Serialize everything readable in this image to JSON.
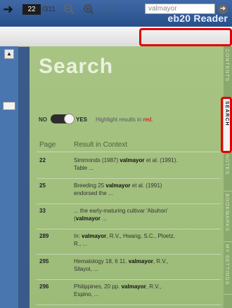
{
  "app": {
    "title": "eb20 Reader"
  },
  "toolbar": {
    "current_page": "22",
    "total_pages": "/311",
    "back_icon": "arrow-right-icon",
    "search_value": "valmayor",
    "search_go_icon": "arrow-circle-icon"
  },
  "panel": {
    "title": "Search",
    "toggle": {
      "no_label": "NO",
      "yes_label": "YES",
      "state": "yes",
      "description": "Highlight results in",
      "description_red": "red."
    },
    "columns": {
      "page": "Page",
      "result": "Result in Context"
    },
    "results": [
      {
        "page": "22",
        "pre": "Simmonds (1987) ",
        "term": "valmayor",
        "post": " et al. (1991). Table ..."
      },
      {
        "page": "25",
        "pre": "Breeding 25 ",
        "term": "valmayor",
        "post": " et al. (1991) endorsed the ..."
      },
      {
        "page": "33",
        "pre": "... the early-maturing cultivar 'Abuhon' (",
        "term": "valmayor",
        "post": " ..."
      },
      {
        "page": "289",
        "pre": "In: ",
        "term": "valmayor",
        "post": ", R.V., Hwang, S.C., Ploetz, R., ..."
      },
      {
        "page": "295",
        "pre": "Hematology 18, 6 11. ",
        "term": "valmayor",
        "post": ", R.V., Silayoi, ..."
      },
      {
        "page": "296",
        "pre": "Philippines, 20 pp. ",
        "term": "valmayor",
        "post": ", R.V., Espino, ..."
      }
    ]
  },
  "tabs": [
    {
      "label": "CONTENTS",
      "active": false
    },
    {
      "label": "SEARCH",
      "active": true
    },
    {
      "label": "NOTES",
      "active": false
    },
    {
      "label": "BOOKMARKS",
      "active": false
    },
    {
      "label": "MY SETTINGS",
      "active": false
    }
  ],
  "colors": {
    "highlight": "#e00000",
    "panel": "#a8c483",
    "titlebar": "#2f5a96"
  }
}
